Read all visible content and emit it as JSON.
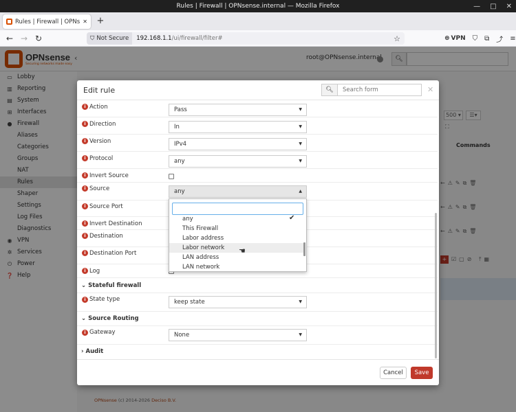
{
  "browser": {
    "window_title": "Rules | Firewall | OPNsense.internal — Mozilla Firefox",
    "tab_title": "Rules | Firewall | OPNsense",
    "new_tab_glyph": "+",
    "security_label": "Not Secure",
    "url_host": "192.168.1.1",
    "url_path": "/ui/firewall/filter#",
    "vpn_label": "VPN"
  },
  "header": {
    "logo_text": "OPNsense",
    "logo_tagline": "Securing networks made easy",
    "user": "root@OPNsense.internal"
  },
  "sidebar": [
    {
      "label": "Lobby",
      "icon": "laptop-icon",
      "glyph": "▭",
      "sub": false,
      "selected": false
    },
    {
      "label": "Reporting",
      "icon": "chart-icon",
      "glyph": "▥",
      "sub": false,
      "selected": false
    },
    {
      "label": "System",
      "icon": "server-icon",
      "glyph": "▤",
      "sub": false,
      "selected": false
    },
    {
      "label": "Interfaces",
      "icon": "network-icon",
      "glyph": "⊞",
      "sub": false,
      "selected": false
    },
    {
      "label": "Firewall",
      "icon": "fire-icon",
      "glyph": "●",
      "sub": false,
      "selected": false
    },
    {
      "label": "Aliases",
      "sub": true,
      "selected": false
    },
    {
      "label": "Categories",
      "sub": true,
      "selected": false
    },
    {
      "label": "Groups",
      "sub": true,
      "selected": false
    },
    {
      "label": "NAT",
      "sub": true,
      "selected": false
    },
    {
      "label": "Rules",
      "sub": true,
      "selected": true
    },
    {
      "label": "Shaper",
      "sub": true,
      "selected": false
    },
    {
      "label": "Settings",
      "sub": true,
      "selected": false
    },
    {
      "label": "Log Files",
      "sub": true,
      "selected": false
    },
    {
      "label": "Diagnostics",
      "sub": true,
      "selected": false
    },
    {
      "label": "VPN",
      "icon": "globe-icon",
      "glyph": "◉",
      "sub": false,
      "selected": false
    },
    {
      "label": "Services",
      "icon": "cog-icon",
      "glyph": "✲",
      "sub": false,
      "selected": false
    },
    {
      "label": "Power",
      "icon": "power-icon",
      "glyph": "⏻",
      "sub": false,
      "selected": false
    },
    {
      "label": "Help",
      "icon": "help-icon",
      "glyph": "❓",
      "sub": false,
      "selected": false
    }
  ],
  "background": {
    "page_size": "500",
    "commands_header": "Commands",
    "footer_brand": "OPNsense",
    "footer_text": " (c) 2014-2026 ",
    "footer_company": "Deciso B.V."
  },
  "modal": {
    "title": "Edit rule",
    "search_placeholder": "Search form",
    "fields": {
      "action": {
        "label": "Action",
        "value": "Pass"
      },
      "direction": {
        "label": "Direction",
        "value": "In"
      },
      "version": {
        "label": "Version",
        "value": "IPv4"
      },
      "protocol": {
        "label": "Protocol",
        "value": "any"
      },
      "invert_source": {
        "label": "Invert Source"
      },
      "source": {
        "label": "Source",
        "value": "any"
      },
      "source_port": {
        "label": "Source Port"
      },
      "invert_destination": {
        "label": "Invert Destination"
      },
      "destination": {
        "label": "Destination"
      },
      "destination_port": {
        "label": "Destination Port"
      },
      "log": {
        "label": "Log"
      },
      "state_type": {
        "label": "State type",
        "value": "keep state"
      },
      "gateway": {
        "label": "Gateway",
        "value": "None"
      }
    },
    "sections": {
      "stateful": "Stateful firewall",
      "source_routing": "Source Routing",
      "audit": "Audit"
    },
    "cancel_label": "Cancel",
    "save_label": "Save"
  },
  "source_dropdown": {
    "search_value": "",
    "options": [
      "any",
      "This Firewall",
      "Labor address",
      "Labor network",
      "LAN address",
      "LAN network"
    ],
    "selected": "any",
    "hovered": "Labor network"
  },
  "colors": {
    "accent": "#d94f00",
    "save": "#c0392b",
    "info": "#c43c2c"
  }
}
